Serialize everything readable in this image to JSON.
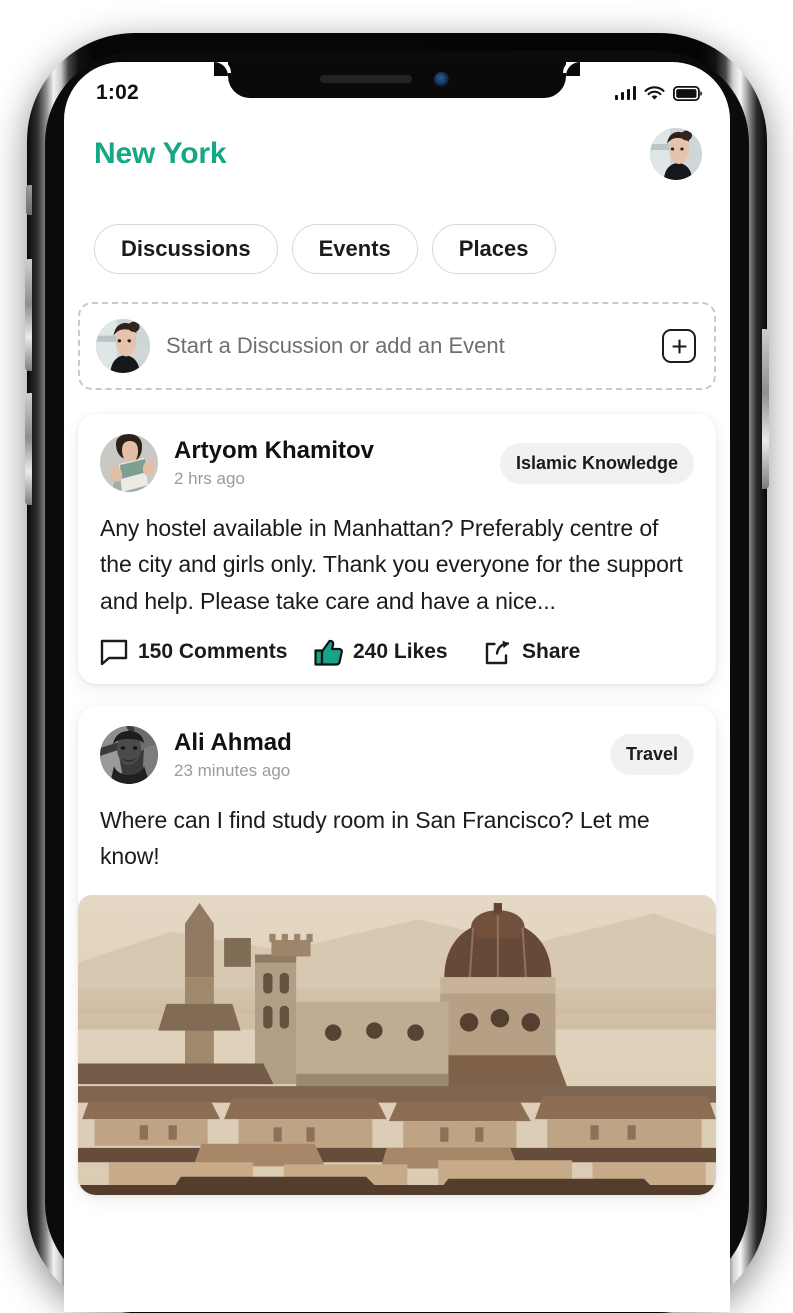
{
  "status_bar": {
    "time": "1:02",
    "signal_icon": "cellular-signal-icon",
    "wifi_icon": "wifi-icon",
    "battery_icon": "battery-full-icon"
  },
  "header": {
    "title": "New York",
    "title_color": "#16a886",
    "avatar_icon": "user-avatar"
  },
  "tabs": [
    {
      "label": "Discussions"
    },
    {
      "label": "Events"
    },
    {
      "label": "Places"
    }
  ],
  "composer": {
    "avatar_icon": "user-avatar",
    "placeholder": "Start a Discussion or add an Event",
    "add_button_icon": "plus-icon"
  },
  "posts": [
    {
      "author": "Artyom Khamitov",
      "time": "2 hrs ago",
      "tag": "Islamic Knowledge",
      "body": "Any hostel available in Manhattan? Preferably centre of the city and girls only. Thank you everyone for the support and help. Please take care and have a nice...",
      "actions": {
        "comments_label": "150 Comments",
        "comments_icon": "comment-bubble-icon",
        "likes_label": "240 Likes",
        "likes_icon": "thumbs-up-icon",
        "likes_color": "#18a287",
        "share_label": "Share",
        "share_icon": "share-icon"
      }
    },
    {
      "author": "Ali Ahmad",
      "time": "23 minutes ago",
      "tag": "Travel",
      "body": "Where can I find study room in San Francisco? Let me know!",
      "photo_alt": "sepia-cityscape-photo"
    }
  ]
}
